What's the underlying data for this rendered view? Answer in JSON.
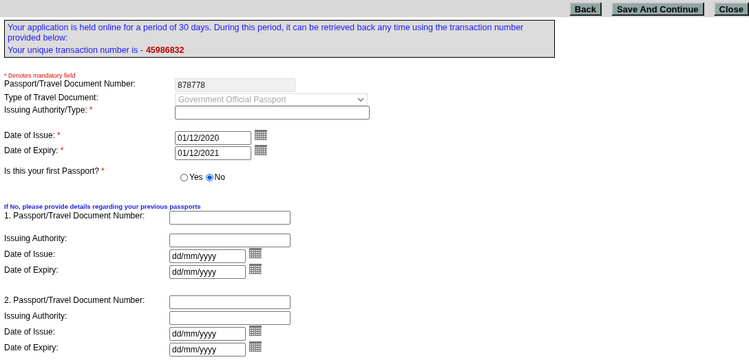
{
  "toolbar": {
    "buttons": [
      "Back",
      "Save And Continue",
      "Close"
    ]
  },
  "notice": {
    "text": "Your application is held online for a period of 30 days. During this period, it can be retrieved back any time using the transaction number provided below:",
    "transaction_label": "Your unique transaction number is -",
    "transaction_number": "45986832"
  },
  "mandatory_note": "* Denotes mandatory field",
  "fields": [
    {
      "kind": "text",
      "label": "Passport/Travel Document Number:",
      "value": "878778",
      "disabled": true
    },
    {
      "kind": "select",
      "label": "Type of Travel Document:",
      "value": "Government Official Passport",
      "disabled": true
    },
    {
      "kind": "wide",
      "label": "Issuing Authority/Type:",
      "mark": "*",
      "disabled": false
    },
    {
      "kind": "date",
      "label": "Date of Issue:",
      "mark": "*",
      "value": "01/12/2020",
      "disabled": false
    },
    {
      "kind": "date",
      "label": "Date of Expiry:",
      "mark": "*",
      "value": "01/12/2021",
      "disabled": false
    },
    {
      "kind": "radio",
      "label": "Is this your first Passport?",
      "mark": "*",
      "options": [
        {
          "label": "Yes",
          "selected": false
        },
        {
          "label": "No",
          "selected": true
        }
      ]
    }
  ],
  "previous_note": "If No, please provide details regarding your previous passports",
  "previous": [
    {
      "fields": [
        {
          "kind": "text",
          "label": "1. Passport/Travel Document Number:"
        },
        {
          "kind": "text",
          "label": "Issuing Authority:"
        },
        {
          "kind": "date",
          "label": "Date of Issue:",
          "value": "dd/mm/yyyy"
        },
        {
          "kind": "date",
          "label": "Date of Expiry:",
          "value": "dd/mm/yyyy"
        }
      ]
    },
    {
      "fields": [
        {
          "kind": "text",
          "label": "2. Passport/Travel Document Number:"
        },
        {
          "kind": "text",
          "label": "Issuing Authority:"
        },
        {
          "kind": "date",
          "label": "Date of Issue:",
          "value": "dd/mm/yyyy"
        },
        {
          "kind": "date",
          "label": "Date of Expiry:",
          "value": "dd/mm/yyyy"
        }
      ]
    }
  ]
}
